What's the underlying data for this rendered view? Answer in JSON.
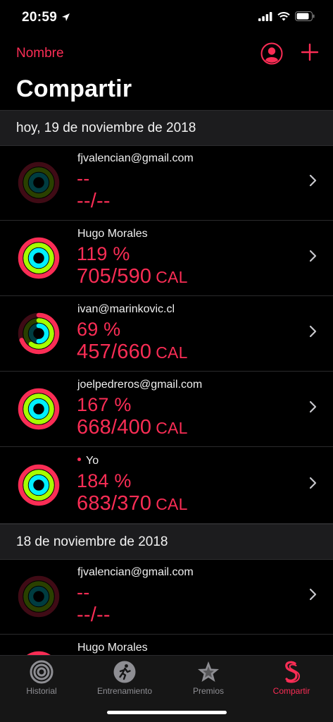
{
  "status": {
    "time": "20:59"
  },
  "nav": {
    "back_label": "Nombre",
    "title": "Compartir"
  },
  "sections": [
    {
      "header": "hoy, 19 de noviembre de 2018"
    },
    {
      "header": "18 de noviembre de 2018"
    }
  ],
  "rows": [
    {
      "name": "fjvalencian@gmail.com",
      "pct": "--",
      "cal": "--/--",
      "unit": "",
      "rings": [
        0,
        0,
        0
      ]
    },
    {
      "name": "Hugo Morales",
      "pct": "119 %",
      "cal": "705/590",
      "unit": "CAL",
      "rings": [
        1.19,
        1.0,
        1.0
      ]
    },
    {
      "name": "ivan@marinkovic.cl",
      "pct": "69 %",
      "cal": "457/660",
      "unit": "CAL",
      "rings": [
        0.69,
        0.6,
        0.5
      ]
    },
    {
      "name": "joelpedreros@gmail.com",
      "pct": "167 %",
      "cal": "668/400",
      "unit": "CAL",
      "rings": [
        1.67,
        1.0,
        1.0
      ]
    },
    {
      "name": "Yo",
      "pct": "184 %",
      "cal": "683/370",
      "unit": "CAL",
      "rings": [
        1.84,
        1.0,
        1.0
      ]
    },
    {
      "name": "fjvalencian@gmail.com",
      "pct": "--",
      "cal": "--/--",
      "unit": "",
      "rings": [
        0,
        0,
        0
      ]
    },
    {
      "name": "Hugo Morales",
      "pct": "",
      "cal": "",
      "unit": "",
      "rings": [
        1.0,
        1.0,
        1.0
      ]
    }
  ],
  "tabs": [
    {
      "label": "Historial",
      "icon": "activity-rings-icon",
      "active": false
    },
    {
      "label": "Entrenamiento",
      "icon": "runner-icon",
      "active": false
    },
    {
      "label": "Premios",
      "icon": "star-award-icon",
      "active": false
    },
    {
      "label": "Compartir",
      "icon": "sharing-icon",
      "active": true
    }
  ],
  "colors": {
    "accent": "#fa2d55",
    "move": "#fa2d55",
    "exercise": "#a6ff00",
    "stand": "#00f0ff",
    "background": "#000000"
  }
}
